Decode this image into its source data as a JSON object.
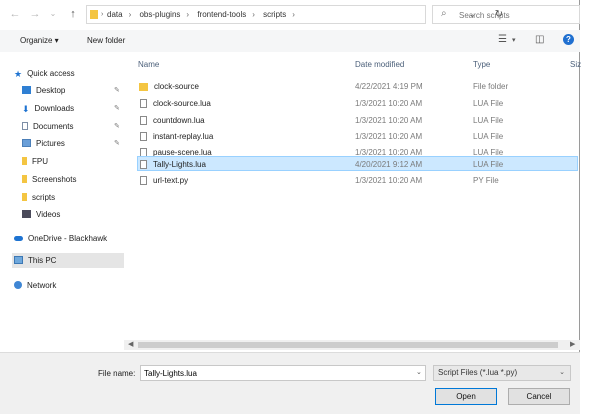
{
  "address": {
    "breadcrumbs": [
      "data",
      "obs-plugins",
      "frontend-tools",
      "scripts"
    ],
    "search_placeholder": "Search scripts"
  },
  "toolbar": {
    "organize_label": "Organize ▾",
    "new_folder_label": "New folder"
  },
  "nav": {
    "items": [
      {
        "label": "Quick access",
        "icon": "star-icon"
      },
      {
        "label": "Desktop",
        "icon": "desktop-icon",
        "pinned": true
      },
      {
        "label": "Downloads",
        "icon": "downloads-icon",
        "pinned": true
      },
      {
        "label": "Documents",
        "icon": "documents-icon",
        "pinned": true
      },
      {
        "label": "Pictures",
        "icon": "pictures-icon",
        "pinned": true
      },
      {
        "label": "FPU",
        "icon": "folder-icon"
      },
      {
        "label": "Screenshots",
        "icon": "folder-icon"
      },
      {
        "label": "scripts",
        "icon": "folder-icon"
      },
      {
        "label": "Videos",
        "icon": "videos-icon"
      },
      {
        "label": "OneDrive - Blackhawk",
        "icon": "onedrive-icon"
      },
      {
        "label": "This PC",
        "icon": "pc-icon",
        "selected": true
      },
      {
        "label": "Network",
        "icon": "network-icon"
      }
    ]
  },
  "list": {
    "columns": [
      "Name",
      "Date modified",
      "Type",
      "Siz"
    ],
    "files": [
      {
        "name": "clock-source",
        "date": "4/22/2021 4:19 PM",
        "type": "File folder",
        "icon": "folder-icon"
      },
      {
        "name": "clock-source.lua",
        "date": "1/3/2021 10:20 AM",
        "type": "LUA File",
        "icon": "file-icon"
      },
      {
        "name": "countdown.lua",
        "date": "1/3/2021 10:20 AM",
        "type": "LUA File",
        "icon": "file-icon"
      },
      {
        "name": "instant-replay.lua",
        "date": "1/3/2021 10:20 AM",
        "type": "LUA File",
        "icon": "file-icon"
      },
      {
        "name": "pause-scene.lua",
        "date": "1/3/2021 10:20 AM",
        "type": "LUA File",
        "icon": "file-icon"
      },
      {
        "name": "Tally-Lights.lua",
        "date": "4/20/2021 9:12 AM",
        "type": "LUA File",
        "icon": "file-icon",
        "selected": true
      },
      {
        "name": "url-text.py",
        "date": "1/3/2021 10:20 AM",
        "type": "PY File",
        "icon": "file-icon"
      }
    ]
  },
  "footer": {
    "file_name_label": "File name:",
    "file_name_value": "Tally-Lights.lua",
    "file_type_value": "Script Files (*.lua *.py)",
    "open_label": "Open",
    "cancel_label": "Cancel"
  }
}
